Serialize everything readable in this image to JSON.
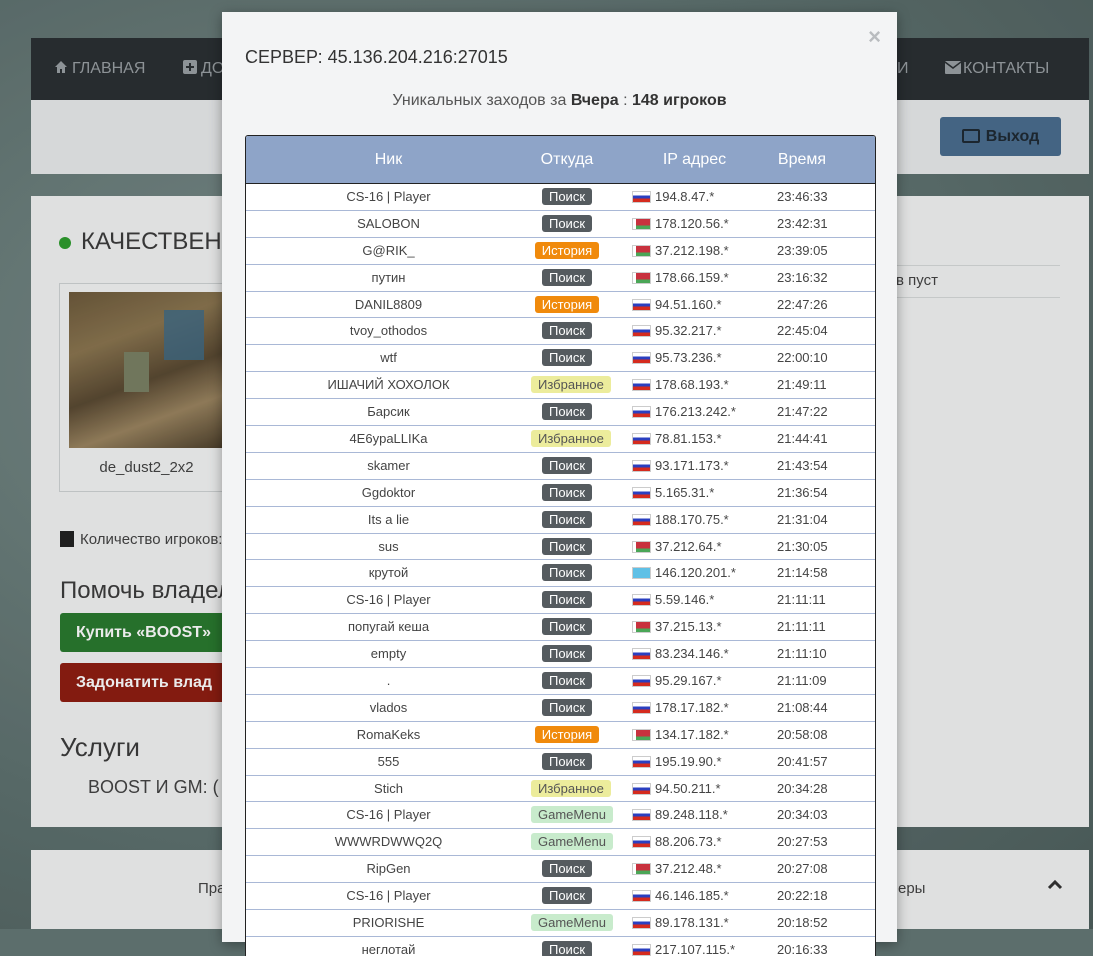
{
  "nav": {
    "home_label": "ГЛАВНАЯ",
    "add_label_partial": "ДО",
    "contacts_label": "КОНТАКТЫ",
    "partial_label": "И"
  },
  "logout_label": "Выход",
  "page": {
    "server_title_partial": "КАЧЕСТВЕНН",
    "map_name": "de_dust2_2x2",
    "players_label": "Количество игроков:",
    "help_title_partial": "Помочь владел",
    "boost_button_partial": "Купить «BOOST»",
    "donate_button_partial": "Задонатить влад",
    "services_title": "Услуги",
    "boost_gm": "BOOST И GM:   (",
    "right_text_partial": "в пуст",
    "footer_left_partial": "Пра",
    "footer_right_partial": "еры"
  },
  "modal": {
    "close_label": "×",
    "title": "СЕРВЕР: 45.136.204.216:27015",
    "unique_prefix": "Уникальных заходов за ",
    "unique_period": "Вчера",
    "unique_sep": " : ",
    "unique_count": "148 игроков",
    "columns": [
      "Ник",
      "Откуда",
      "IP адрес",
      "Время"
    ],
    "rows": [
      {
        "nick": "CS-16 | Player",
        "from": "Поиск",
        "type": "search",
        "flag": "ru",
        "ip": "194.8.47.*",
        "time": "23:46:33"
      },
      {
        "nick": "SALOBON",
        "from": "Поиск",
        "type": "search",
        "flag": "by",
        "ip": "178.120.56.*",
        "time": "23:42:31"
      },
      {
        "nick": "G@RIK_",
        "from": "История",
        "type": "history",
        "flag": "by",
        "ip": "37.212.198.*",
        "time": "23:39:05"
      },
      {
        "nick": "путин",
        "from": "Поиск",
        "type": "search",
        "flag": "by",
        "ip": "178.66.159.*",
        "time": "23:16:32"
      },
      {
        "nick": "DANIL8809",
        "from": "История",
        "type": "history",
        "flag": "ru",
        "ip": "94.51.160.*",
        "time": "22:47:26"
      },
      {
        "nick": "tvoy_othodos",
        "from": "Поиск",
        "type": "search",
        "flag": "ru",
        "ip": "95.32.217.*",
        "time": "22:45:04"
      },
      {
        "nick": "wtf",
        "from": "Поиск",
        "type": "search",
        "flag": "ru",
        "ip": "95.73.236.*",
        "time": "22:00:10"
      },
      {
        "nick": "ИШАЧИЙ ХОХОЛОК",
        "from": "Избранное",
        "type": "fav",
        "flag": "ru",
        "ip": "178.68.193.*",
        "time": "21:49:11"
      },
      {
        "nick": "Барсик",
        "from": "Поиск",
        "type": "search",
        "flag": "ru",
        "ip": "176.213.242.*",
        "time": "21:47:22"
      },
      {
        "nick": "4E6ypaLLIKa",
        "from": "Избранное",
        "type": "fav",
        "flag": "ru",
        "ip": "78.81.153.*",
        "time": "21:44:41"
      },
      {
        "nick": "skamer",
        "from": "Поиск",
        "type": "search",
        "flag": "ru",
        "ip": "93.171.173.*",
        "time": "21:43:54"
      },
      {
        "nick": "Ggdoktor",
        "from": "Поиск",
        "type": "search",
        "flag": "ru",
        "ip": "5.165.31.*",
        "time": "21:36:54"
      },
      {
        "nick": "Its a lie",
        "from": "Поиск",
        "type": "search",
        "flag": "ru",
        "ip": "188.170.75.*",
        "time": "21:31:04"
      },
      {
        "nick": "sus",
        "from": "Поиск",
        "type": "search",
        "flag": "by",
        "ip": "37.212.64.*",
        "time": "21:30:05"
      },
      {
        "nick": "крутой",
        "from": "Поиск",
        "type": "search",
        "flag": "kz",
        "ip": "146.120.201.*",
        "time": "21:14:58"
      },
      {
        "nick": "CS-16 | Player",
        "from": "Поиск",
        "type": "search",
        "flag": "ru",
        "ip": "5.59.146.*",
        "time": "21:11:11"
      },
      {
        "nick": "попугай кеша",
        "from": "Поиск",
        "type": "search",
        "flag": "by",
        "ip": "37.215.13.*",
        "time": "21:11:11"
      },
      {
        "nick": "empty",
        "from": "Поиск",
        "type": "search",
        "flag": "ru",
        "ip": "83.234.146.*",
        "time": "21:11:10"
      },
      {
        "nick": ".",
        "from": "Поиск",
        "type": "search",
        "flag": "ru",
        "ip": "95.29.167.*",
        "time": "21:11:09"
      },
      {
        "nick": "vlados",
        "from": "Поиск",
        "type": "search",
        "flag": "ru",
        "ip": "178.17.182.*",
        "time": "21:08:44"
      },
      {
        "nick": "RomaKeks",
        "from": "История",
        "type": "history",
        "flag": "by",
        "ip": "134.17.182.*",
        "time": "20:58:08"
      },
      {
        "nick": "555",
        "from": "Поиск",
        "type": "search",
        "flag": "ru",
        "ip": "195.19.90.*",
        "time": "20:41:57"
      },
      {
        "nick": "Stich",
        "from": "Избранное",
        "type": "fav",
        "flag": "ru",
        "ip": "94.50.211.*",
        "time": "20:34:28"
      },
      {
        "nick": "CS-16 | Player",
        "from": "GameMenu",
        "type": "gm",
        "flag": "ru",
        "ip": "89.248.118.*",
        "time": "20:34:03"
      },
      {
        "nick": "WWWRDWWQ2Q",
        "from": "GameMenu",
        "type": "gm",
        "flag": "ru",
        "ip": "88.206.73.*",
        "time": "20:27:53"
      },
      {
        "nick": "RipGen",
        "from": "Поиск",
        "type": "search",
        "flag": "by",
        "ip": "37.212.48.*",
        "time": "20:27:08"
      },
      {
        "nick": "CS-16 | Player",
        "from": "Поиск",
        "type": "search",
        "flag": "ru",
        "ip": "46.146.185.*",
        "time": "20:22:18"
      },
      {
        "nick": "PRIORISHE",
        "from": "GameMenu",
        "type": "gm",
        "flag": "ru",
        "ip": "89.178.131.*",
        "time": "20:18:52"
      },
      {
        "nick": "неглотай",
        "from": "Поиск",
        "type": "search",
        "flag": "ru",
        "ip": "217.107.115.*",
        "time": "20:16:33"
      }
    ]
  }
}
